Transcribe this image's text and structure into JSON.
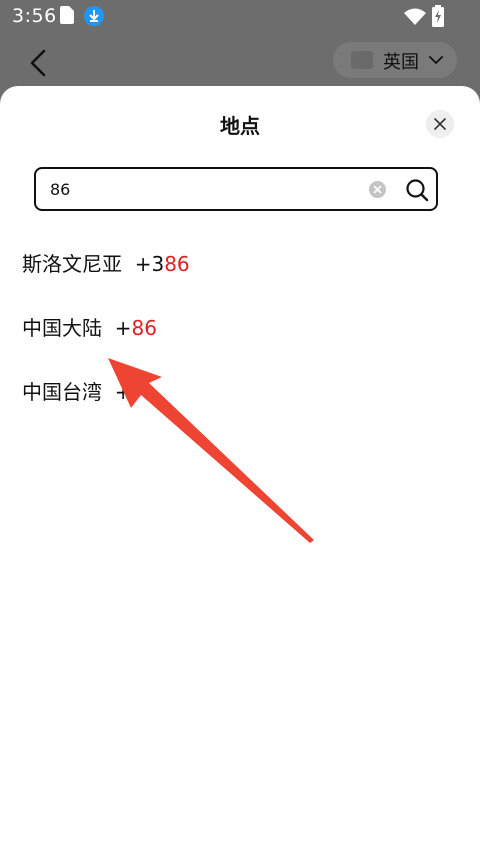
{
  "statusbar": {
    "time": "3:56"
  },
  "background_header": {
    "region_label": "英国"
  },
  "sheet": {
    "title": "地点",
    "search": {
      "value": "86",
      "placeholder": ""
    }
  },
  "results": [
    {
      "name": "斯洛文尼亚",
      "prefix": "+3",
      "match": "86"
    },
    {
      "name": "中国大陆",
      "prefix": "+",
      "match": "86"
    },
    {
      "name": "中国台湾",
      "prefix": "+",
      "match": ""
    }
  ],
  "colors": {
    "highlight": "#e02020",
    "arrow": "#ee4433",
    "download_badge": "#2196f3"
  },
  "icons": [
    "back-arrow-icon",
    "chevron-down-icon",
    "close-icon",
    "clear-icon",
    "search-icon",
    "wifi-icon",
    "battery-icon",
    "download-icon",
    "sim-icon"
  ]
}
